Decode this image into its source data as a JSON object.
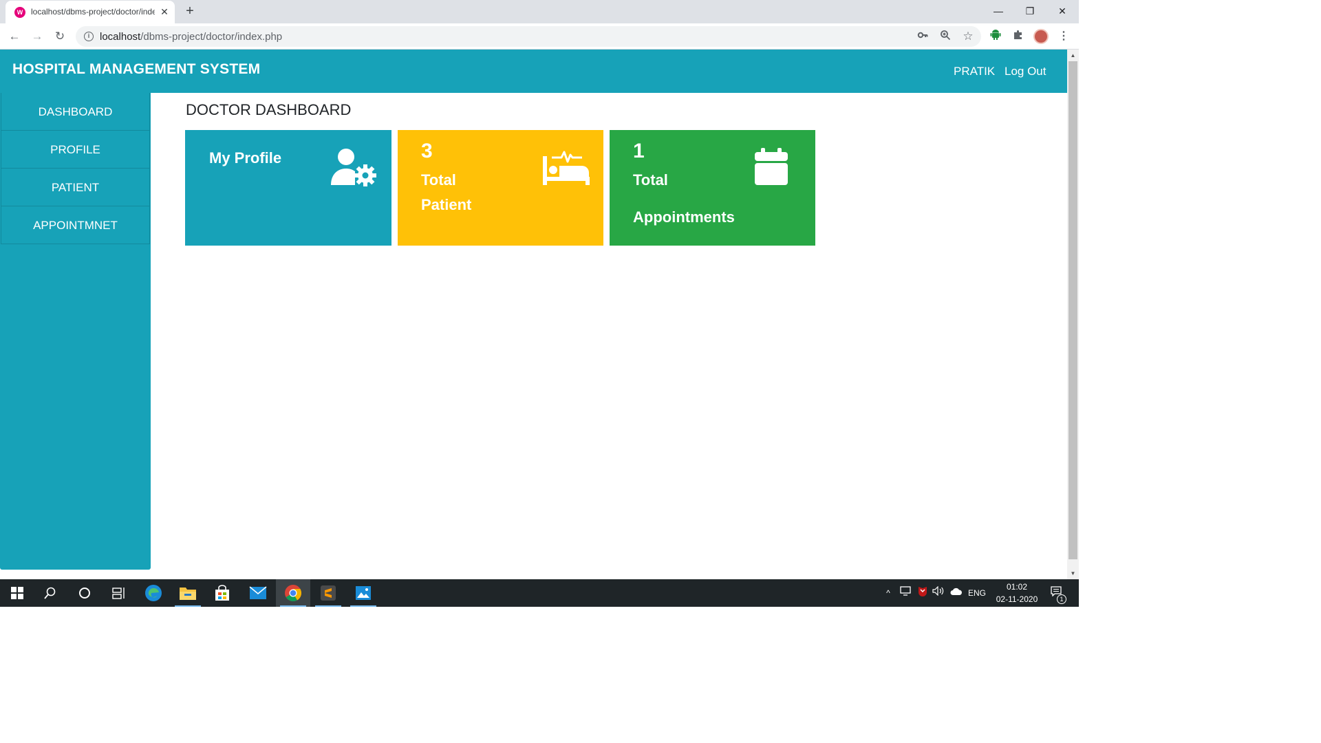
{
  "browser": {
    "tab_title": "localhost/dbms-project/doctor/index.php",
    "favicon_letter": "W",
    "url_host": "localhost",
    "url_path": "/dbms-project/doctor/index.php",
    "window_controls": {
      "minimize": "—",
      "restore": "❐",
      "close": "✕"
    }
  },
  "navbar": {
    "brand": "HOSPITAL MANAGEMENT SYSTEM",
    "user": "PRATIK",
    "logout": "Log Out",
    "color": "#17a2b8"
  },
  "sidebar": {
    "items": [
      {
        "label": "DASHBOARD"
      },
      {
        "label": "PROFILE"
      },
      {
        "label": "PATIENT"
      },
      {
        "label": "APPOINTMNET"
      }
    ]
  },
  "main": {
    "heading": "DOCTOR DASHBOARD",
    "cards": [
      {
        "title": "My Profile",
        "icon": "user-gear-icon",
        "color": "#17a2b8"
      },
      {
        "count": "3",
        "label_line1": "Total",
        "label_line2": "Patient",
        "icon": "bed-pulse-icon",
        "color": "#ffc107"
      },
      {
        "count": "1",
        "label_line1": "Total",
        "label_line2": "Appointments",
        "icon": "calendar-icon",
        "color": "#28a745"
      }
    ]
  },
  "taskbar": {
    "language": "ENG",
    "time": "01:02",
    "date": "02-11-2020",
    "notification_count": "1"
  }
}
